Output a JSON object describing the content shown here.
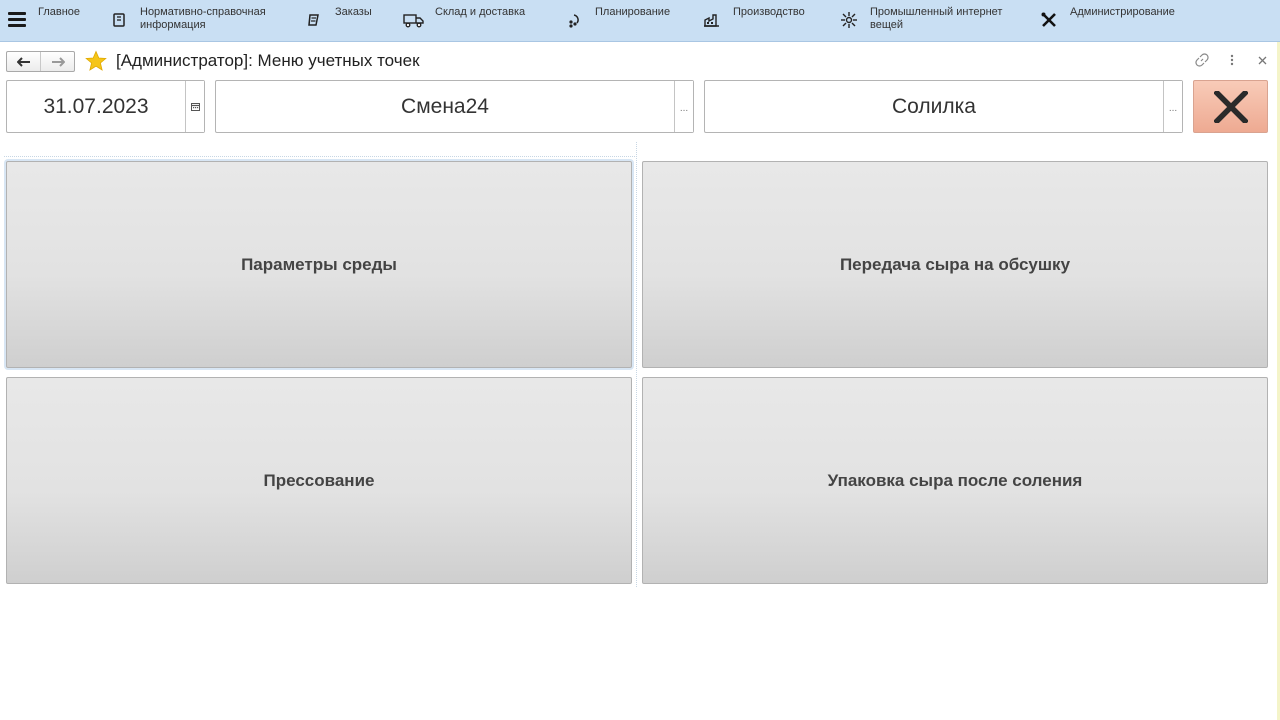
{
  "nav": {
    "items": [
      {
        "label": "Главное",
        "icon": "menu-icon"
      },
      {
        "label": "Нормативно-справочная\nинформация",
        "icon": "reference-book-icon"
      },
      {
        "label": "Заказы",
        "icon": "orders-icon"
      },
      {
        "label": "Склад и доставка",
        "icon": "delivery-truck-icon"
      },
      {
        "label": "Планирование",
        "icon": "planning-icon"
      },
      {
        "label": "Производство",
        "icon": "factory-icon"
      },
      {
        "label": "Промышленный интернет\nвещей",
        "icon": "iot-icon"
      },
      {
        "label": "Администрирование",
        "icon": "tools-icon"
      }
    ]
  },
  "window": {
    "title": "[Администратор]: Меню учетных точек"
  },
  "fields": {
    "date": "31.07.2023",
    "shift": "Смена24",
    "workplace": "Солилка",
    "choose_label": "..."
  },
  "tiles": [
    {
      "label": "Параметры среды"
    },
    {
      "label": "Передача сыра на обсушку"
    },
    {
      "label": "Прессование"
    },
    {
      "label": "Упаковка сыра после соления"
    }
  ],
  "colors": {
    "section_bar": "#c9dff3",
    "close_button": "#eeaa92",
    "star": "#f5c518"
  }
}
